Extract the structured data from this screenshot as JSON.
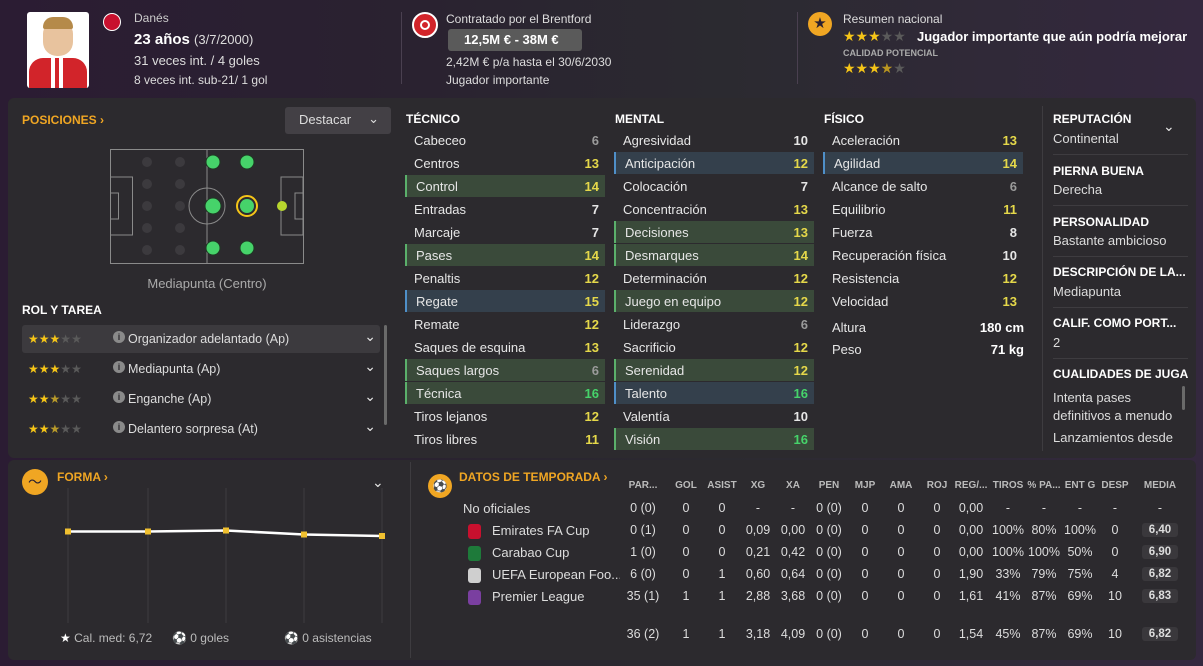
{
  "header": {
    "nationality": "Danés",
    "age": "23 años",
    "birth": "(3/7/2000)",
    "caps": "31 veces int. / 4 goles",
    "u21": "8 veces int. sub-21/ 1 gol",
    "contract_label": "Contratado por el Brentford",
    "value": "12,5M € - 38M €",
    "wage": "2,42M € p/a hasta el 30/6/2030",
    "status": "Jugador importante",
    "national_label": "Resumen nacional",
    "national_desc": "Jugador importante que aún podría mejorar",
    "potential_label": "CALIDAD POTENCIAL",
    "current_stars": 3,
    "potential_stars": 3.5
  },
  "positions": {
    "title": "POSICIONES ›",
    "highlight_button": "Destacar",
    "position_name": "Mediapunta (Centro)",
    "roles_title": "ROL Y TAREA",
    "roles": [
      {
        "name": "Organizador adelantado (Ap)",
        "stars": 3
      },
      {
        "name": "Mediapunta (Ap)",
        "stars": 3
      },
      {
        "name": "Enganche (Ap)",
        "stars": 2.5
      },
      {
        "name": "Delantero sorpresa (At)",
        "stars": 2.5
      }
    ]
  },
  "technical": {
    "title": "TÉCNICO",
    "rows": [
      {
        "n": "Cabeceo",
        "v": "6"
      },
      {
        "n": "Centros",
        "v": "13"
      },
      {
        "n": "Control",
        "v": "14"
      },
      {
        "n": "Entradas",
        "v": "7"
      },
      {
        "n": "Marcaje",
        "v": "7"
      },
      {
        "n": "Pases",
        "v": "14"
      },
      {
        "n": "Penaltis",
        "v": "12"
      },
      {
        "n": "Regate",
        "v": "15"
      },
      {
        "n": "Remate",
        "v": "12"
      },
      {
        "n": "Saques de esquina",
        "v": "13"
      },
      {
        "n": "Saques largos",
        "v": "6"
      },
      {
        "n": "Técnica",
        "v": "16"
      },
      {
        "n": "Tiros lejanos",
        "v": "12"
      },
      {
        "n": "Tiros libres",
        "v": "11"
      }
    ]
  },
  "mental": {
    "title": "MENTAL",
    "rows": [
      {
        "n": "Agresividad",
        "v": "10"
      },
      {
        "n": "Anticipación",
        "v": "12"
      },
      {
        "n": "Colocación",
        "v": "7"
      },
      {
        "n": "Concentración",
        "v": "13"
      },
      {
        "n": "Decisiones",
        "v": "13"
      },
      {
        "n": "Desmarques",
        "v": "14"
      },
      {
        "n": "Determinación",
        "v": "12"
      },
      {
        "n": "Juego en equipo",
        "v": "12"
      },
      {
        "n": "Liderazgo",
        "v": "6"
      },
      {
        "n": "Sacrificio",
        "v": "12"
      },
      {
        "n": "Serenidad",
        "v": "12"
      },
      {
        "n": "Talento",
        "v": "16"
      },
      {
        "n": "Valentía",
        "v": "10"
      },
      {
        "n": "Visión",
        "v": "16"
      }
    ]
  },
  "physical": {
    "title": "FÍSICO",
    "rows": [
      {
        "n": "Aceleración",
        "v": "13"
      },
      {
        "n": "Agilidad",
        "v": "14"
      },
      {
        "n": "Alcance de salto",
        "v": "6"
      },
      {
        "n": "Equilibrio",
        "v": "11"
      },
      {
        "n": "Fuerza",
        "v": "8"
      },
      {
        "n": "Recuperación física",
        "v": "10"
      },
      {
        "n": "Resistencia",
        "v": "12"
      },
      {
        "n": "Velocidad",
        "v": "13"
      }
    ],
    "height_label": "Altura",
    "height": "180 cm",
    "weight_label": "Peso",
    "weight": "71 kg"
  },
  "side": {
    "rep_l": "REPUTACIÓN",
    "rep_v": "Continental",
    "foot_l": "PIERNA BUENA",
    "foot_v": "Derecha",
    "pers_l": "PERSONALIDAD",
    "pers_v": "Bastante ambicioso",
    "desc_l": "DESCRIPCIÓN DE LA...",
    "desc_v": "Mediapunta",
    "gk_l": "CALIF. COMO PORT...",
    "gk_v": "2",
    "qual_l": "CUALIDADES DE JUGA",
    "qual_1": "Intenta pases",
    "qual_2": "definitivos a menudo",
    "qual_3": "Lanzamientos desde"
  },
  "form": {
    "title": "FORMA ›",
    "avg": "Cal. med: 6,72",
    "goals": "0 goles",
    "assists": "0 asistencias"
  },
  "season": {
    "title": "DATOS DE TEMPORADA ›",
    "headers": [
      "PAR...",
      "GOL",
      "ASIST",
      "XG",
      "XA",
      "PEN",
      "MJP",
      "AMA",
      "ROJ",
      "REG/...",
      "TIROS",
      "% PA...",
      "ENT G",
      "DESP",
      "MEDIA"
    ],
    "rows": [
      {
        "comp": "No oficiales",
        "cells": [
          "0 (0)",
          "0",
          "0",
          "-",
          "-",
          "0 (0)",
          "0",
          "0",
          "0",
          "0,00",
          "-",
          "-",
          "-",
          "-",
          "-"
        ]
      },
      {
        "comp": "Emirates FA Cup",
        "cells": [
          "0 (1)",
          "0",
          "0",
          "0,09",
          "0,00",
          "0 (0)",
          "0",
          "0",
          "0",
          "0,00",
          "100%",
          "80%",
          "100%",
          "0",
          "6,40"
        ]
      },
      {
        "comp": "Carabao Cup",
        "cells": [
          "1 (0)",
          "0",
          "0",
          "0,21",
          "0,42",
          "0 (0)",
          "0",
          "0",
          "0",
          "0,00",
          "100%",
          "100%",
          "50%",
          "0",
          "6,90"
        ]
      },
      {
        "comp": "UEFA European Foo...",
        "cells": [
          "6 (0)",
          "0",
          "1",
          "0,60",
          "0,64",
          "0 (0)",
          "0",
          "0",
          "0",
          "1,90",
          "33%",
          "79%",
          "75%",
          "4",
          "6,82"
        ]
      },
      {
        "comp": "Premier League",
        "cells": [
          "35 (1)",
          "1",
          "1",
          "2,88",
          "3,68",
          "0 (0)",
          "0",
          "0",
          "0",
          "1,61",
          "41%",
          "87%",
          "69%",
          "10",
          "6,83"
        ]
      }
    ],
    "total": [
      "36 (2)",
      "1",
      "1",
      "3,18",
      "4,09",
      "0 (0)",
      "0",
      "0",
      "0",
      "1,54",
      "45%",
      "87%",
      "69%",
      "10",
      "6,82"
    ]
  },
  "colors": {
    "accent": "#f0a623",
    "green": "#46d36a",
    "yellow": "#e5d84a"
  }
}
